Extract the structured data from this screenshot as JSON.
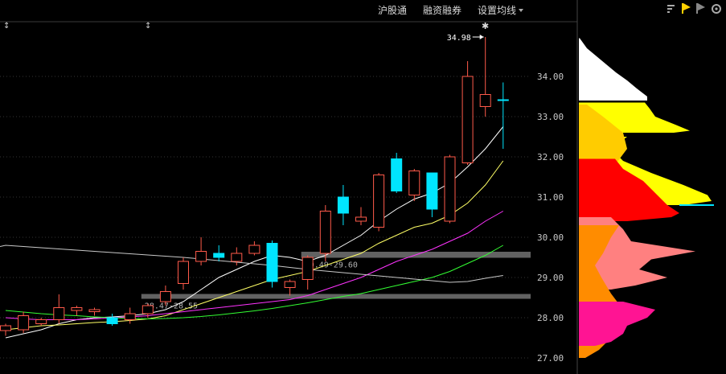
{
  "toolbar": {
    "shanghai_connect": "沪股通",
    "margin_trading": "融资融券",
    "set_ma": "设置均线",
    "dropdown_icon": "triangle-down-icon"
  },
  "panel_icons": [
    "bars-icon",
    "flag-yellow-icon",
    "flag-gray-icon",
    "gear-icon"
  ],
  "colors": {
    "up": "#ff5a4a",
    "down": "#00e5ff",
    "ma5": "#ffffff",
    "ma10": "#ffff66",
    "ma20": "#ff33ff",
    "ma60": "#33ff33",
    "ma_long": "#c8c8c8"
  },
  "chart_data": {
    "type": "candlestick",
    "ylim": [
      26.9,
      35.5
    ],
    "yticks": [
      "27.00",
      "28.00",
      "29.00",
      "30.00",
      "31.00",
      "32.00",
      "33.00",
      "34.00"
    ],
    "candles": [
      {
        "o": 27.68,
        "h": 27.85,
        "l": 27.55,
        "c": 27.8
      },
      {
        "o": 27.7,
        "h": 28.15,
        "l": 27.62,
        "c": 28.05
      },
      {
        "o": 27.85,
        "h": 28.0,
        "l": 27.8,
        "c": 27.95
      },
      {
        "o": 27.95,
        "h": 28.58,
        "l": 27.85,
        "c": 28.25
      },
      {
        "o": 28.18,
        "h": 28.3,
        "l": 28.05,
        "c": 28.25
      },
      {
        "o": 28.15,
        "h": 28.25,
        "l": 28.05,
        "c": 28.2
      },
      {
        "o": 28.0,
        "h": 28.1,
        "l": 27.8,
        "c": 27.85
      },
      {
        "o": 27.95,
        "h": 28.25,
        "l": 27.85,
        "c": 28.1
      },
      {
        "o": 28.1,
        "h": 28.35,
        "l": 28.0,
        "c": 28.3
      },
      {
        "o": 28.4,
        "h": 28.8,
        "l": 28.3,
        "c": 28.65
      },
      {
        "o": 28.85,
        "h": 29.5,
        "l": 28.7,
        "c": 29.4
      },
      {
        "o": 29.4,
        "h": 30.0,
        "l": 29.3,
        "c": 29.65
      },
      {
        "o": 29.6,
        "h": 29.8,
        "l": 29.4,
        "c": 29.5
      },
      {
        "o": 29.4,
        "h": 29.75,
        "l": 29.3,
        "c": 29.6
      },
      {
        "o": 29.6,
        "h": 29.9,
        "l": 29.55,
        "c": 29.8
      },
      {
        "o": 29.85,
        "h": 29.92,
        "l": 28.75,
        "c": 28.9
      },
      {
        "o": 28.75,
        "h": 28.95,
        "l": 28.55,
        "c": 28.9
      },
      {
        "o": 28.95,
        "h": 29.55,
        "l": 28.7,
        "c": 29.5
      },
      {
        "o": 29.6,
        "h": 30.8,
        "l": 29.4,
        "c": 30.65
      },
      {
        "o": 31.0,
        "h": 31.3,
        "l": 30.3,
        "c": 30.6
      },
      {
        "o": 30.4,
        "h": 30.75,
        "l": 30.3,
        "c": 30.5
      },
      {
        "o": 30.25,
        "h": 31.6,
        "l": 30.15,
        "c": 31.55
      },
      {
        "o": 31.95,
        "h": 32.1,
        "l": 31.1,
        "c": 31.15
      },
      {
        "o": 31.05,
        "h": 31.7,
        "l": 30.9,
        "c": 31.65
      },
      {
        "o": 31.6,
        "h": 31.6,
        "l": 30.5,
        "c": 30.7
      },
      {
        "o": 30.4,
        "h": 32.05,
        "l": 30.35,
        "c": 32.0
      },
      {
        "o": 31.85,
        "h": 34.38,
        "l": 31.8,
        "c": 34.0
      },
      {
        "o": 33.25,
        "h": 34.98,
        "l": 33.0,
        "c": 33.55
      },
      {
        "o": 33.42,
        "h": 33.85,
        "l": 32.2,
        "c": 33.4
      }
    ],
    "ma_lines": [
      {
        "name": "MA5",
        "color_key": "ma5",
        "start": 0,
        "values": [
          27.5,
          27.6,
          27.7,
          27.85,
          27.95,
          28.0,
          28.02,
          28.05,
          28.1,
          28.2,
          28.4,
          28.7,
          29.0,
          29.2,
          29.4,
          29.55,
          29.5,
          29.4,
          29.55,
          29.8,
          30.05,
          30.4,
          30.7,
          30.95,
          31.1,
          31.35,
          31.75,
          32.2,
          32.75
        ]
      },
      {
        "name": "MA10",
        "color_key": "ma10",
        "start": 0,
        "values": [
          27.7,
          27.75,
          27.8,
          27.82,
          27.85,
          27.88,
          27.9,
          27.93,
          27.97,
          28.05,
          28.2,
          28.35,
          28.5,
          28.65,
          28.8,
          28.95,
          29.05,
          29.15,
          29.3,
          29.45,
          29.6,
          29.85,
          30.05,
          30.25,
          30.35,
          30.55,
          30.85,
          31.3,
          31.9
        ]
      },
      {
        "name": "MA20",
        "color_key": "ma20",
        "start": 0,
        "values": [
          28.0,
          27.97,
          27.95,
          27.95,
          27.95,
          27.97,
          28.0,
          28.02,
          28.05,
          28.1,
          28.15,
          28.2,
          28.25,
          28.3,
          28.35,
          28.4,
          28.45,
          28.55,
          28.7,
          28.85,
          29.0,
          29.2,
          29.4,
          29.55,
          29.7,
          29.9,
          30.1,
          30.4,
          30.65
        ]
      },
      {
        "name": "MA60",
        "color_key": "ma60",
        "start": 0,
        "values": [
          28.18,
          28.14,
          28.1,
          28.07,
          28.05,
          28.02,
          28.0,
          27.98,
          27.97,
          27.98,
          28.0,
          28.03,
          28.07,
          28.12,
          28.17,
          28.23,
          28.3,
          28.37,
          28.45,
          28.53,
          28.6,
          28.7,
          28.8,
          28.9,
          29.0,
          29.15,
          29.35,
          29.55,
          29.8
        ]
      },
      {
        "name": "MA_LONG",
        "color_key": "ma_long",
        "start": 0,
        "values": [
          29.8,
          29.77,
          29.74,
          29.71,
          29.68,
          29.65,
          29.62,
          29.59,
          29.56,
          29.53,
          29.5,
          29.46,
          29.42,
          29.38,
          29.34,
          29.3,
          29.25,
          29.2,
          29.16,
          29.12,
          29.08,
          29.04,
          29.0,
          28.96,
          28.92,
          28.88,
          28.9,
          28.98,
          29.05
        ]
      }
    ],
    "zones": [
      {
        "label": "28.47-28.55",
        "low": 28.47,
        "high": 28.55,
        "from": 8
      },
      {
        "label": "29.49-29.60",
        "low": 29.49,
        "high": 29.6,
        "from": 17
      }
    ],
    "high_annotation": {
      "label": "34.98",
      "value": 34.98,
      "index": 27
    },
    "profile": {
      "segments": [
        {
          "from": 33.4,
          "to": 34.95,
          "color": "#ffffff",
          "pts": [
            [
              34.95,
              1
            ],
            [
              34.7,
              10
            ],
            [
              34.4,
              28
            ],
            [
              34.1,
              46
            ],
            [
              33.9,
              60
            ],
            [
              33.7,
              72
            ],
            [
              33.5,
              85
            ],
            [
              33.4,
              85
            ]
          ]
        },
        {
          "from": 32.6,
          "to": 33.35,
          "color": "#ffff00",
          "pts": [
            [
              33.35,
              82
            ],
            [
              33.2,
              88
            ],
            [
              33.0,
              95
            ],
            [
              32.8,
              120
            ],
            [
              32.65,
              138
            ],
            [
              32.6,
              118
            ]
          ]
        },
        {
          "from": 30.8,
          "to": 32.55,
          "color": "#ffff00",
          "pts": [
            [
              32.5,
              60
            ],
            [
              32.2,
              40
            ],
            [
              31.9,
              55
            ],
            [
              31.6,
              90
            ],
            [
              31.3,
              130
            ],
            [
              31.05,
              160
            ],
            [
              30.9,
              165
            ],
            [
              30.8,
              130
            ]
          ]
        },
        {
          "from": 27.0,
          "to": 33.3,
          "color": "#ffcc00",
          "pts": [
            [
              33.3,
              10
            ],
            [
              33.0,
              30
            ],
            [
              32.6,
              55
            ],
            [
              32.2,
              60
            ],
            [
              31.8,
              45
            ],
            [
              31.4,
              30
            ],
            [
              31.0,
              25
            ],
            [
              30.6,
              25
            ],
            [
              30.2,
              20
            ],
            [
              29.8,
              14
            ],
            [
              29.4,
              10
            ],
            [
              29.0,
              8
            ],
            [
              28.6,
              6
            ],
            [
              28.2,
              4
            ],
            [
              27.8,
              3
            ],
            [
              27.4,
              2
            ],
            [
              27.0,
              1
            ]
          ]
        },
        {
          "from": 30.4,
          "to": 31.95,
          "color": "#ff0000",
          "pts": [
            [
              31.95,
              45
            ],
            [
              31.7,
              55
            ],
            [
              31.4,
              80
            ],
            [
              31.1,
              95
            ],
            [
              30.8,
              110
            ],
            [
              30.6,
              125
            ],
            [
              30.5,
              115
            ],
            [
              30.4,
              60
            ]
          ]
        },
        {
          "from": 28.7,
          "to": 30.5,
          "color": "#ff8080",
          "pts": [
            [
              30.5,
              40
            ],
            [
              30.2,
              55
            ],
            [
              29.9,
              65
            ],
            [
              29.65,
              145
            ],
            [
              29.45,
              90
            ],
            [
              29.2,
              75
            ],
            [
              29.0,
              110
            ],
            [
              28.8,
              70
            ],
            [
              28.7,
              40
            ]
          ]
        },
        {
          "from": 27.0,
          "to": 30.3,
          "color": "#ff8c00",
          "pts": [
            [
              30.3,
              50
            ],
            [
              30.0,
              40
            ],
            [
              29.6,
              30
            ],
            [
              29.3,
              20
            ],
            [
              29.0,
              28
            ],
            [
              28.6,
              40
            ],
            [
              28.2,
              55
            ],
            [
              27.8,
              50
            ],
            [
              27.5,
              40
            ],
            [
              27.2,
              25
            ],
            [
              27.0,
              8
            ]
          ]
        },
        {
          "from": 27.3,
          "to": 28.4,
          "color": "#ff1493",
          "pts": [
            [
              28.4,
              55
            ],
            [
              28.2,
              95
            ],
            [
              28.0,
              85
            ],
            [
              27.8,
              60
            ],
            [
              27.6,
              55
            ],
            [
              27.4,
              40
            ],
            [
              27.3,
              20
            ]
          ]
        }
      ],
      "current_price": 30.8
    }
  }
}
